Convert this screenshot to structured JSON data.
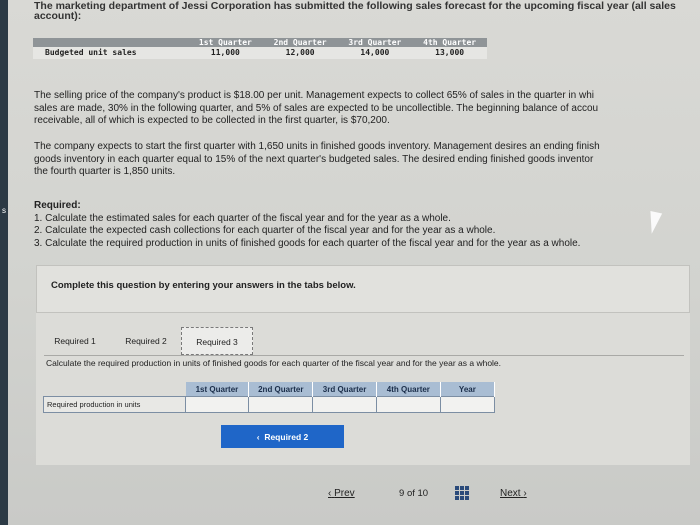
{
  "header": {
    "intro_line1": "The marketing department of Jessi Corporation has submitted the following sales forecast for the upcoming fiscal year (all sales",
    "intro_line2": "account):"
  },
  "forecast": {
    "headers": [
      "1st Quarter",
      "2nd Quarter",
      "3rd Quarter",
      "4th Quarter"
    ],
    "row_label": "Budgeted unit sales",
    "values": [
      "11,000",
      "12,000",
      "14,000",
      "13,000"
    ]
  },
  "paragraphs": {
    "p1": [
      "The selling price of the company's product is $18.00 per unit. Management expects to collect 65% of sales in the quarter in whi",
      "sales are made, 30% in the following quarter, and 5% of sales are expected to be uncollectible. The beginning balance of accou",
      "receivable, all of which is expected to be collected in the first quarter, is $70,200."
    ],
    "p2": [
      "The company expects to start the first quarter with 1,650 units in finished goods inventory. Management desires an ending finish",
      "goods inventory in each quarter equal to 15% of the next quarter's budgeted sales. The desired ending finished goods inventor",
      "the fourth quarter is 1,850 units."
    ]
  },
  "required": {
    "title": "Required:",
    "items": [
      "1. Calculate the estimated sales for each quarter of the fiscal year and for the year as a whole.",
      "2. Calculate the expected cash collections for each quarter of the fiscal year and for the year as a whole.",
      "3. Calculate the required production in units of finished goods for each quarter of the fiscal year and for the year as a whole."
    ]
  },
  "card": {
    "text": "Complete this question by entering your answers in the tabs below."
  },
  "tabs": [
    "Required 1",
    "Required 2",
    "Required 3"
  ],
  "instruction": "Calculate the required production in units of finished goods for each quarter of the fiscal year and for the year as a whole.",
  "production_table": {
    "headers": [
      "1st Quarter",
      "2nd Quarter",
      "3rd Quarter",
      "4th Quarter",
      "Year"
    ],
    "row_label": "Required production in units"
  },
  "buttons": {
    "prev_tab": "Required 2"
  },
  "nav": {
    "prev": "Prev",
    "page_current": "9",
    "page_of": "of",
    "page_total": "10",
    "next": "Next"
  },
  "colors": {
    "accent": "#1f66c8",
    "table_header": "#a9bdd3",
    "forecast_header": "#8f9497",
    "sidebar": "#2c3a45"
  }
}
